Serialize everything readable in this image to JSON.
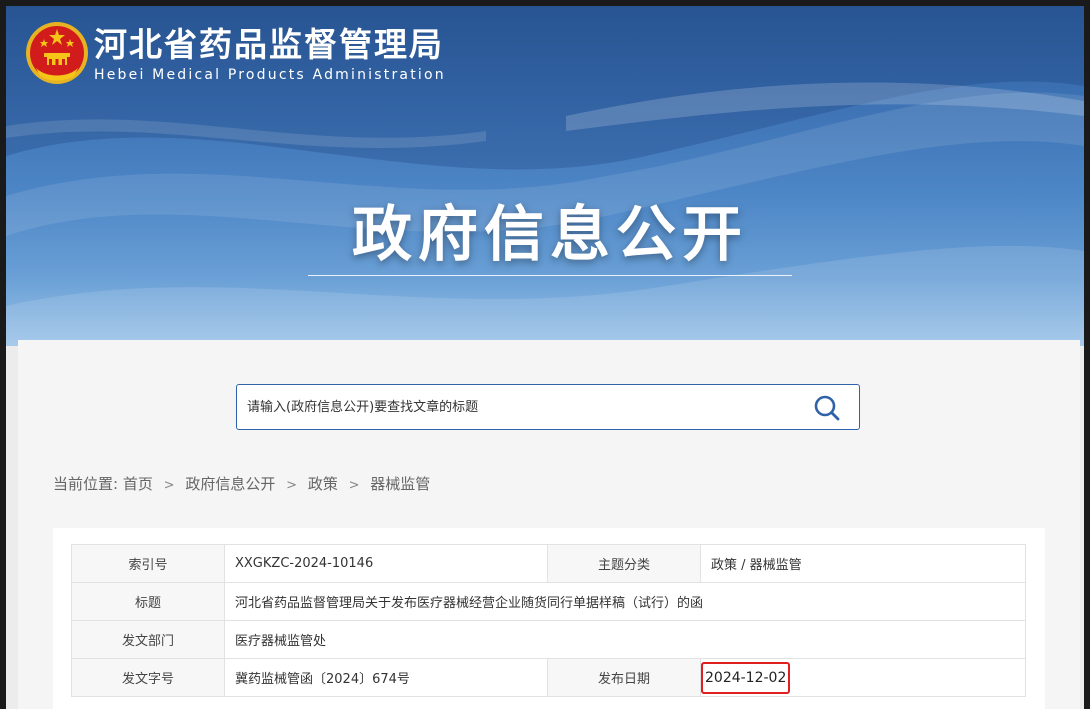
{
  "header": {
    "site_name_cn": "河北省药品监督管理局",
    "site_name_en": "Hebei Medical Products Administration",
    "banner_heading": "政府信息公开",
    "emblem_icon": "national-emblem-icon"
  },
  "search": {
    "placeholder": "请输入(政府信息公开)要查找文章的标题",
    "button_icon": "search-icon",
    "accent_color": "#2f62a8"
  },
  "breadcrumb": {
    "prefix": "当前位置:",
    "items": [
      "首页",
      "政府信息公开",
      "政策",
      "器械监管"
    ],
    "separator": ">"
  },
  "info": {
    "index_label": "索引号",
    "index_value": "XXGKZC-2024-10146",
    "category_label": "主题分类",
    "category_value": "政策 / 器械监管",
    "title_label": "标题",
    "title_value": "河北省药品监督管理局关于发布医疗器械经营企业随货同行单据样稿（试行）的函",
    "dept_label": "发文部门",
    "dept_value": "医疗器械监管处",
    "docno_label": "发文字号",
    "docno_value": "冀药监械管函〔2024〕674号",
    "date_label": "发布日期",
    "date_value": "2024-12-02",
    "highlight_color": "#e02020"
  }
}
